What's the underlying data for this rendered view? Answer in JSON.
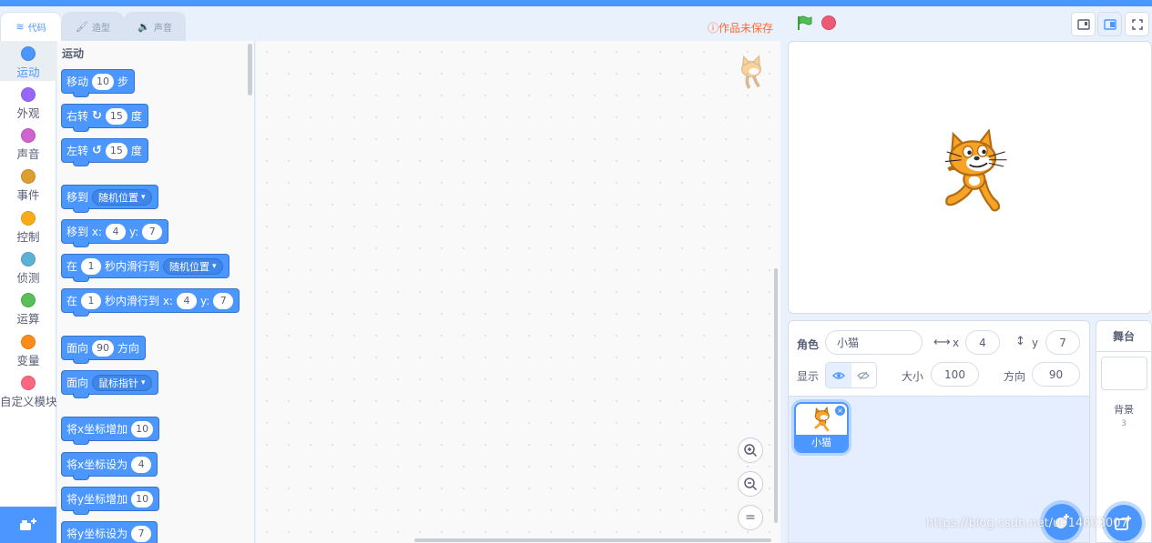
{
  "tabs": {
    "code": "代码",
    "costumes": "造型",
    "sounds": "声音"
  },
  "categories": [
    {
      "label": "运动",
      "color": "#4c97ff"
    },
    {
      "label": "外观",
      "color": "#9966ff"
    },
    {
      "label": "声音",
      "color": "#cf63cf"
    },
    {
      "label": "事件",
      "color": "#de9e2e"
    },
    {
      "label": "控制",
      "color": "#ffab19"
    },
    {
      "label": "侦测",
      "color": "#5cb1d6"
    },
    {
      "label": "运算",
      "color": "#59c059"
    },
    {
      "label": "变量",
      "color": "#ff8c1a"
    },
    {
      "label": "自定义模块",
      "color": "#ff6680"
    }
  ],
  "palette": {
    "title": "运动",
    "move": {
      "t1": "移动",
      "v": "10",
      "t2": "步"
    },
    "turn_right": {
      "t1": "右转",
      "v": "15",
      "t2": "度"
    },
    "turn_left": {
      "t1": "左转",
      "v": "15",
      "t2": "度"
    },
    "goto": {
      "t1": "移到",
      "d": "随机位置"
    },
    "goto_xy": {
      "t1": "移到 x:",
      "x": "4",
      "t2": "y:",
      "y": "7"
    },
    "glide": {
      "t1": "在",
      "v": "1",
      "t2": "秒内滑行到",
      "d": "随机位置"
    },
    "glide_xy": {
      "t1": "在",
      "v": "1",
      "t2": "秒内滑行到 x:",
      "x": "4",
      "t3": "y:",
      "y": "7"
    },
    "point_dir": {
      "t1": "面向",
      "v": "90",
      "t2": "方向"
    },
    "point_towards": {
      "t1": "面向",
      "d": "鼠标指针"
    },
    "change_x": {
      "t1": "将x坐标增加",
      "v": "10"
    },
    "set_x": {
      "t1": "将x坐标设为",
      "v": "4"
    },
    "change_y": {
      "t1": "将y坐标增加",
      "v": "10"
    },
    "set_y": {
      "t1": "将y坐标设为",
      "v": "7"
    }
  },
  "unsaved": "作品未保存",
  "sprite_info": {
    "sprite_label": "角色",
    "sprite_name": "小猫",
    "x_label": "x",
    "x": "4",
    "y_label": "y",
    "y": "7",
    "show_label": "显示",
    "size_label": "大小",
    "size": "100",
    "direction_label": "方向",
    "direction": "90"
  },
  "sprites": [
    {
      "name": "小猫"
    }
  ],
  "stage_panel": {
    "title": "舞台",
    "backdrops_label": "背景",
    "backdrops_count": "3"
  },
  "watermark": "https://blog.csdn.net/u014603007",
  "colors": {
    "accent": "#4c97ff",
    "stop": "#ec5a73",
    "flag": "#4cbf56",
    "unsaved": "#ff6b34"
  }
}
